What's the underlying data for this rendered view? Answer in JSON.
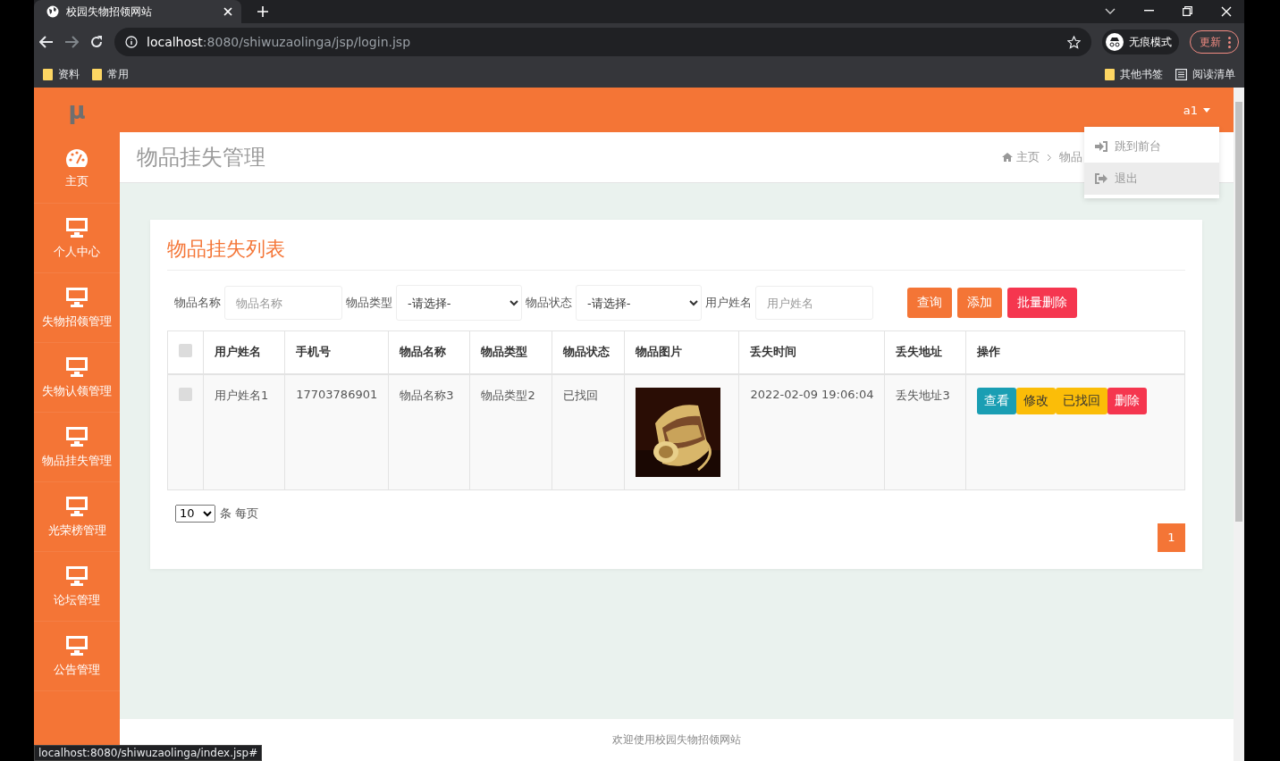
{
  "browser": {
    "tab_title": "校园失物招领网站",
    "url_host": "localhost",
    "url_rest": ":8080/shiwuzaolinga/jsp/login.jsp",
    "incognito_label": "无痕模式",
    "update_label": "更新",
    "bookmarks": [
      "资料",
      "常用"
    ],
    "other_bookmarks": "其他书签",
    "reading_list": "阅读清单"
  },
  "sidebar": {
    "logo": "μ",
    "items": [
      {
        "label": "主页",
        "kind": "dashboard"
      },
      {
        "label": "个人中心",
        "kind": "monitor"
      },
      {
        "label": "失物招领管理",
        "kind": "monitor"
      },
      {
        "label": "失物认领管理",
        "kind": "monitor"
      },
      {
        "label": "物品挂失管理",
        "kind": "monitor"
      },
      {
        "label": "光荣榜管理",
        "kind": "monitor"
      },
      {
        "label": "论坛管理",
        "kind": "monitor"
      },
      {
        "label": "公告管理",
        "kind": "monitor"
      }
    ]
  },
  "user_menu": {
    "user": "a1",
    "items": [
      {
        "label": "跳到前台",
        "kind": "enter",
        "selected": false
      },
      {
        "label": "退出",
        "kind": "exit",
        "selected": true
      }
    ]
  },
  "page_title": "物品挂失管理",
  "breadcrumb": [
    "主页",
    "物品"
  ],
  "card": {
    "title": "物品挂失列表",
    "filters": [
      {
        "label": "物品名称",
        "kind": "text",
        "placeholder": "物品名称"
      },
      {
        "label": "物品类型",
        "kind": "select",
        "value": "-请选择-"
      },
      {
        "label": "物品状态",
        "kind": "select",
        "value": "-请选择-"
      },
      {
        "label": "用户姓名",
        "kind": "text",
        "placeholder": "用户姓名"
      }
    ],
    "buttons": [
      {
        "label": "查询",
        "color": "#f47536"
      },
      {
        "label": "添加",
        "color": "#f47536"
      },
      {
        "label": "批量删除",
        "color": "#f5364f"
      }
    ],
    "table": {
      "select_all_checked": false,
      "columns": [
        "用户姓名",
        "手机号",
        "物品名称",
        "物品类型",
        "物品状态",
        "物品图片",
        "丢失时间",
        "丢失地址",
        "操作"
      ],
      "rows": [
        {
          "checked": false,
          "cells": [
            "用户姓名1",
            "17703786901",
            "物品名称3",
            "物品类型2",
            "已找回",
            {
              "kind": "picture"
            },
            "2022-02-09 19:06:04",
            "丢失地址3"
          ],
          "actions": [
            {
              "label": "查看",
              "color": "#1a9eb3"
            },
            {
              "label": "修改",
              "color": "#fbbd08"
            },
            {
              "label": "已找回",
              "color": "#fbbd08"
            },
            {
              "label": "删除",
              "color": "#f5364f"
            }
          ]
        }
      ]
    },
    "page_size": "10",
    "page_size_label": "条 每页",
    "pages": [
      {
        "label": "1",
        "selected": true
      }
    ]
  },
  "footer": "欢迎使用校园失物招领网站",
  "status_url": "localhost:8080/shiwuzaolinga/index.jsp#"
}
